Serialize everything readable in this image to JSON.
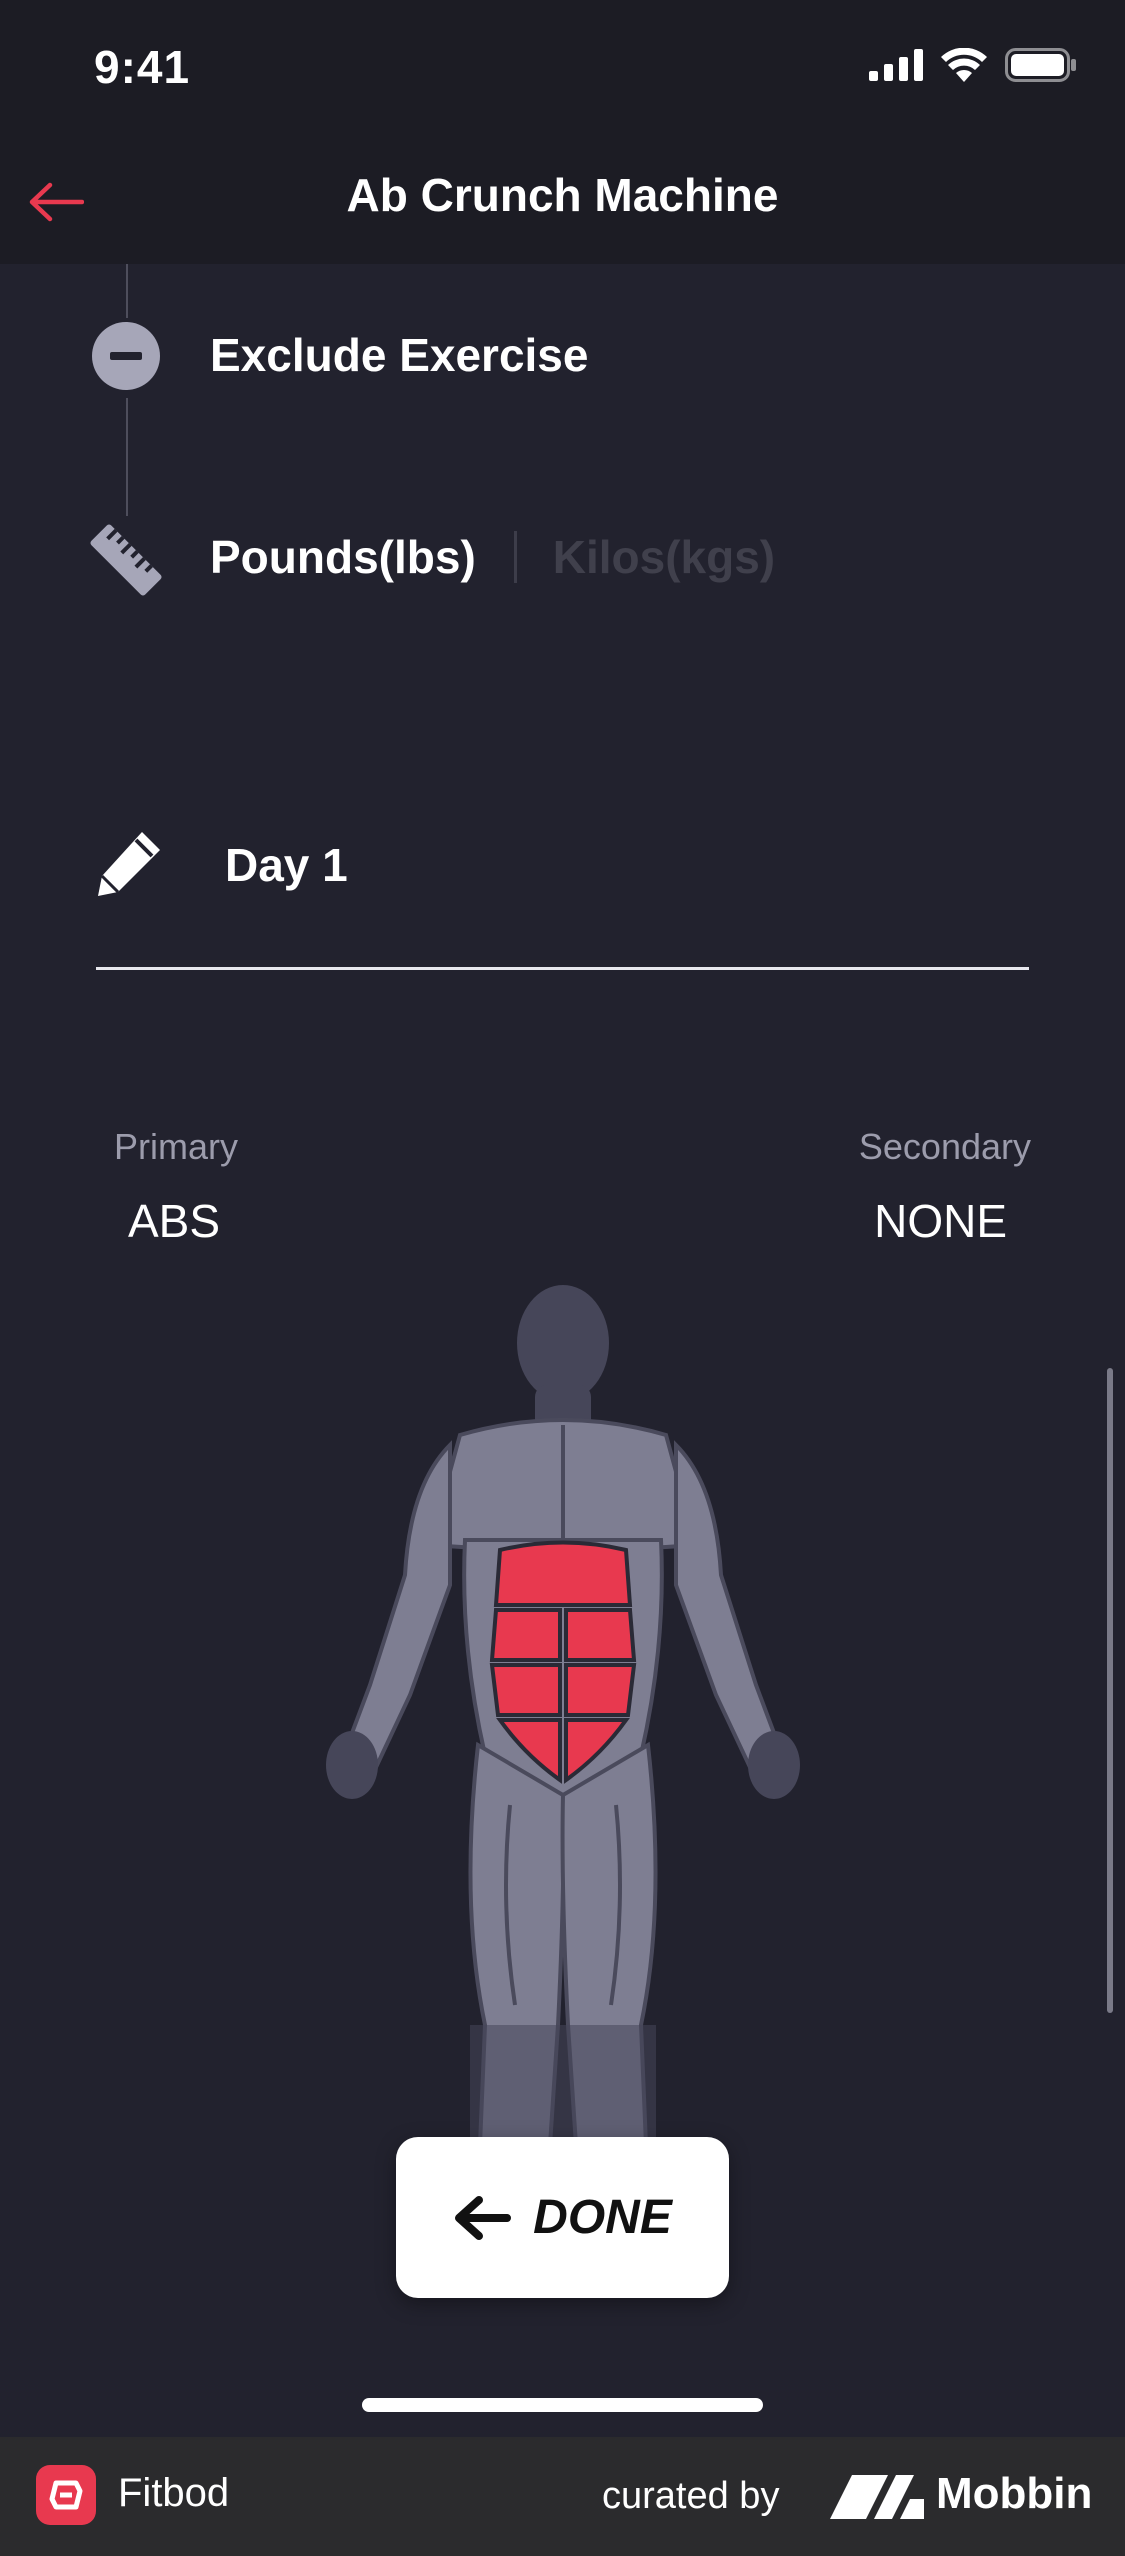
{
  "status_bar": {
    "time": "9:41"
  },
  "nav": {
    "title": "Ab Crunch Machine"
  },
  "settings": {
    "exclude_label": "Exclude Exercise",
    "unit_active": "Pounds(lbs)",
    "unit_inactive": "Kilos(kgs)"
  },
  "workout": {
    "day_label": "Day 1"
  },
  "muscles": {
    "primary_caption": "Primary",
    "primary_value": "ABS",
    "secondary_caption": "Secondary",
    "secondary_value": "NONE"
  },
  "done_button": {
    "label": "DONE"
  },
  "footer": {
    "app_name": "Fitbod",
    "curated_label": "curated by",
    "brand_name": "Mobbin"
  },
  "colors": {
    "accent": "#e8394f",
    "background": "#22222e",
    "nav_background": "#1c1c24",
    "muscle_highlight": "#e8394f",
    "body_gray": "#7e7e92"
  }
}
